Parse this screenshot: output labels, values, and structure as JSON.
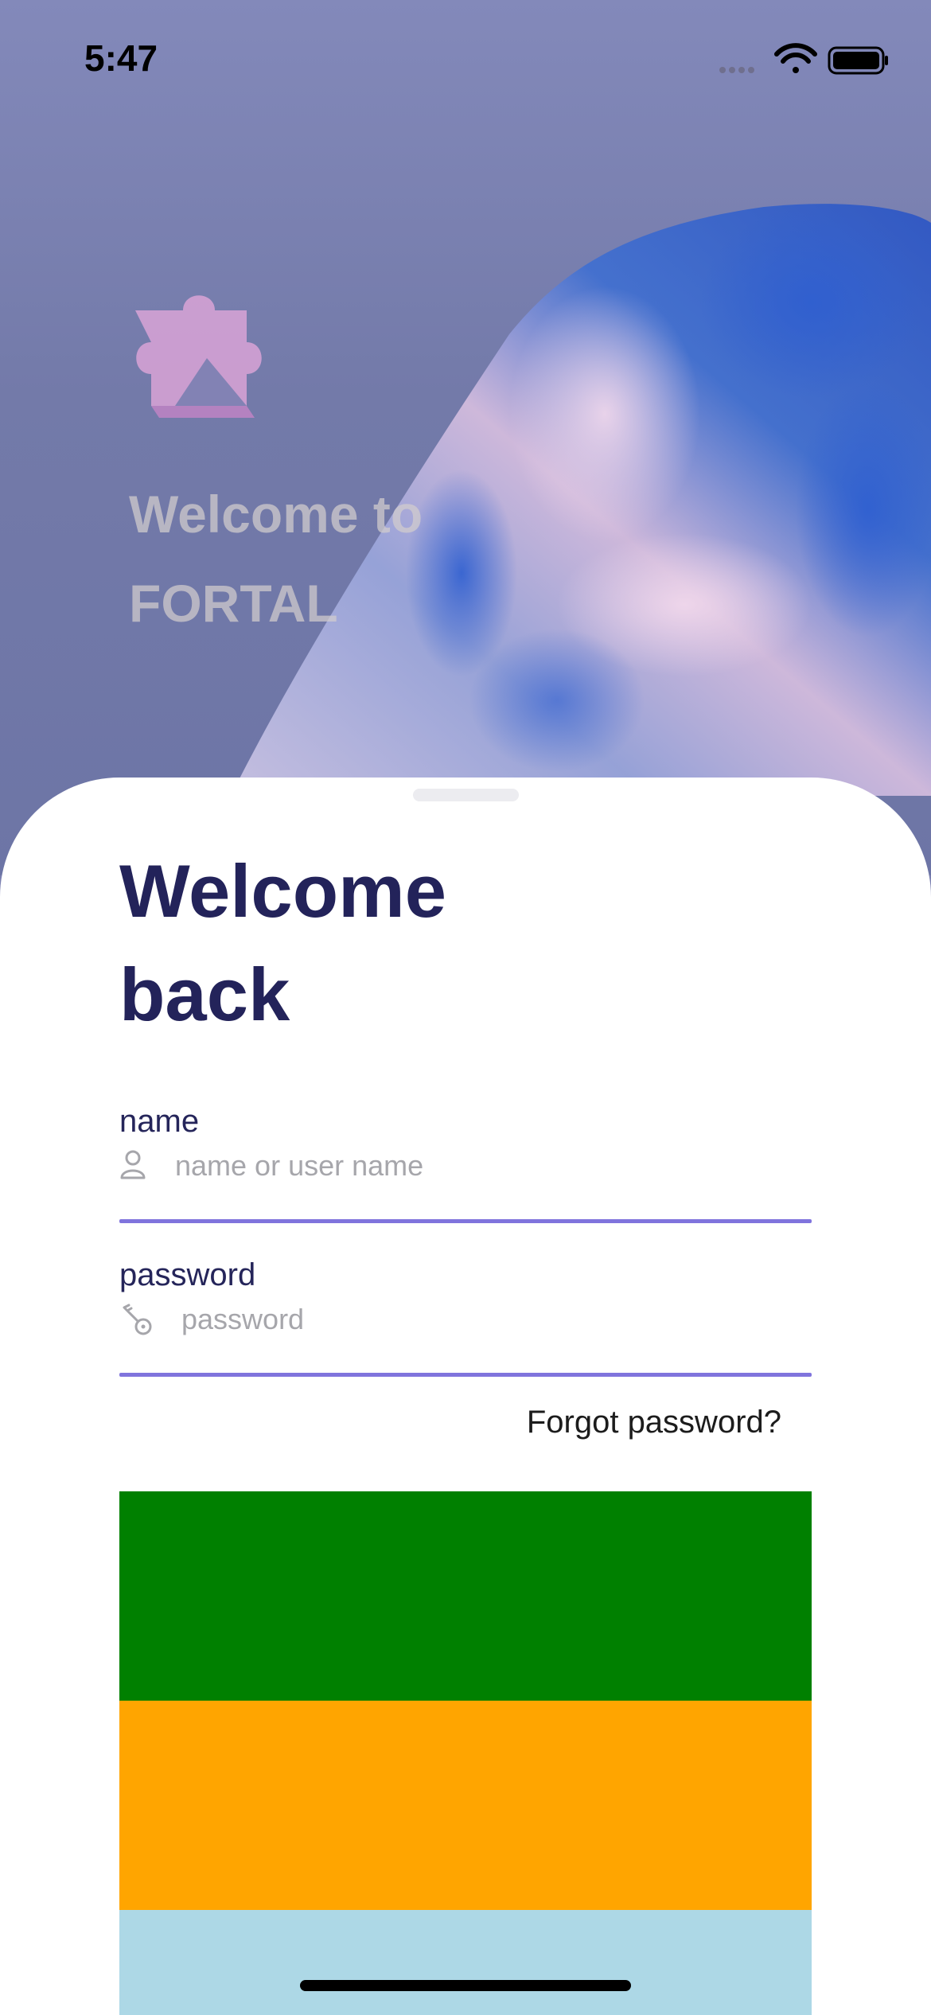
{
  "status_bar": {
    "time": "5:47"
  },
  "hero": {
    "line1": "Welcome to",
    "line2": "FORTAL"
  },
  "login": {
    "title_line1": "Welcome",
    "title_line2": "back",
    "name_label": "name",
    "name_placeholder": "name or user name",
    "name_value": "",
    "password_label": "password",
    "password_placeholder": "password",
    "password_value": "",
    "forgot_link": "Forgot password?"
  },
  "icons": {
    "name_field": "user-icon",
    "password_field": "key-icon",
    "logo": "puzzle-piece-icon"
  },
  "colors": {
    "accent": "#8074dd",
    "title": "#23235a",
    "block_1": "#008000",
    "block_2": "#FFA500",
    "block_3": "#ADD8E6"
  }
}
